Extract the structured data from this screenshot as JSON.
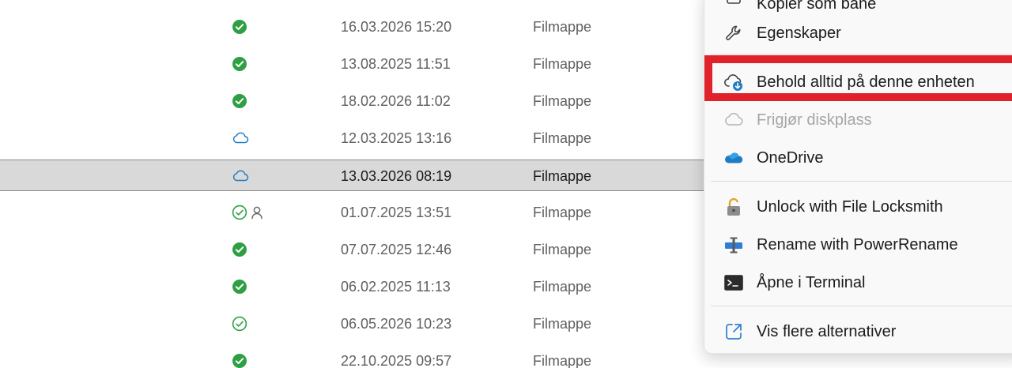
{
  "file_rows": [
    {
      "status": "available-synced",
      "shared": false,
      "modified": "16.03.2026 15:20",
      "type": "Filmappe",
      "selected": false
    },
    {
      "status": "available-synced",
      "shared": false,
      "modified": "13.08.2025 11:51",
      "type": "Filmappe",
      "selected": false
    },
    {
      "status": "available-synced",
      "shared": false,
      "modified": "18.02.2026 11:02",
      "type": "Filmappe",
      "selected": false
    },
    {
      "status": "online-only",
      "shared": false,
      "modified": "12.03.2025 13:16",
      "type": "Filmappe",
      "selected": false
    },
    {
      "status": "online-only",
      "shared": false,
      "modified": "13.03.2026 08:19",
      "type": "Filmappe",
      "selected": true
    },
    {
      "status": "locally-available",
      "shared": true,
      "modified": "01.07.2025 13:51",
      "type": "Filmappe",
      "selected": false
    },
    {
      "status": "available-synced",
      "shared": false,
      "modified": "07.07.2025 12:46",
      "type": "Filmappe",
      "selected": false
    },
    {
      "status": "available-synced",
      "shared": false,
      "modified": "06.02.2025 11:13",
      "type": "Filmappe",
      "selected": false
    },
    {
      "status": "locally-available",
      "shared": false,
      "modified": "06.05.2026 10:23",
      "type": "Filmappe",
      "selected": false
    },
    {
      "status": "available-synced",
      "shared": false,
      "modified": "22.10.2025 09:57",
      "type": "Filmappe",
      "selected": false
    }
  ],
  "context_menu": {
    "partial_top_label": "Kopier som bane",
    "properties_label": "Egenskaper",
    "keep_on_device_label": "Behold alltid på denne enheten",
    "free_space_label": "Frigjør diskplass",
    "onedrive_label": "OneDrive",
    "unlock_label": "Unlock with File Locksmith",
    "rename_label": "Rename with PowerRename",
    "terminal_label": "Åpne i Terminal",
    "more_options_label": "Vis flere alternativer",
    "highlight_color": "#e1222a"
  },
  "colors": {
    "synced_green": "#2ea043",
    "cloud_blue": "#1f7bc4",
    "selected_row": "#d9d9d9"
  }
}
